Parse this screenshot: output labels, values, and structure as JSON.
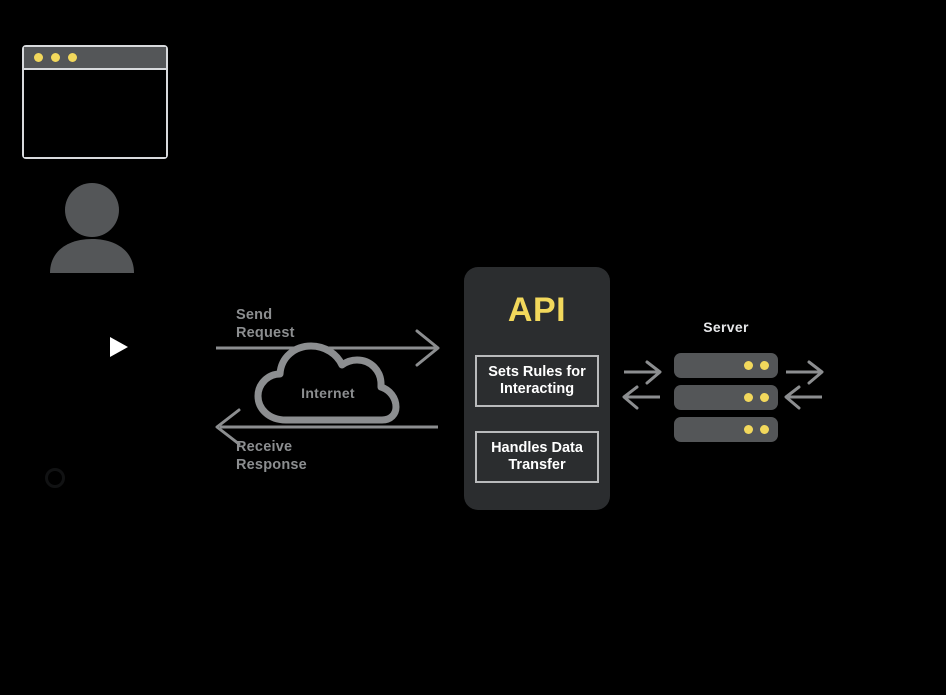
{
  "diagram": {
    "background_color": "#000000",
    "accent_yellow": "#F2D85C",
    "gray": "#8C8E90",
    "panel_dark": "#2B2D2F"
  },
  "client": {
    "browser_window": {
      "name": "browser-window",
      "dots": [
        "dot-1",
        "dot-2",
        "dot-3"
      ]
    },
    "user_icon_name": "user-icon",
    "play_icon_name": "play-icon",
    "circle_icon_name": "circle-icon"
  },
  "flow": {
    "send": {
      "label": "Send\nRequest",
      "direction": "right"
    },
    "receive": {
      "label": "Receive\nResponse",
      "direction": "left"
    },
    "cloud": {
      "label": "Internet",
      "icon_name": "cloud-icon"
    }
  },
  "api": {
    "title": "API",
    "cards": [
      {
        "label": "Sets Rules for\nInteracting"
      },
      {
        "label": "Handles Data\nTransfer"
      }
    ]
  },
  "server": {
    "label": "Server",
    "bars": [
      {
        "leds": 2
      },
      {
        "leds": 2
      },
      {
        "leds": 2
      }
    ]
  },
  "exchange_arrows": {
    "left_pair_name": "api-server-exchange-arrows",
    "right_pair_name": "server-outbound-exchange-arrows"
  }
}
